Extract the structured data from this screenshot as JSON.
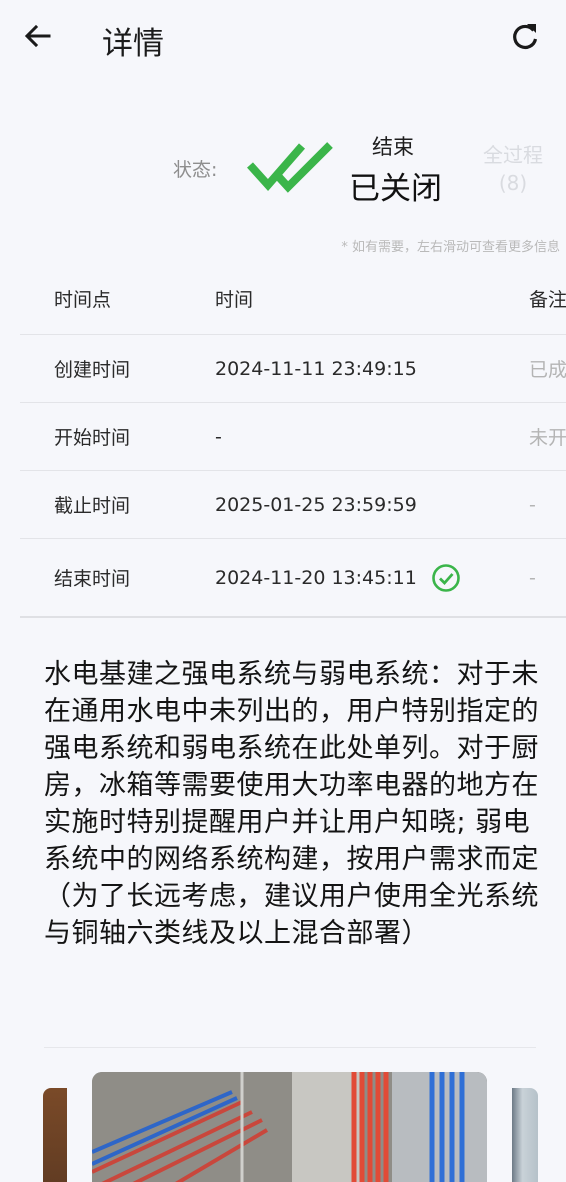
{
  "header": {
    "title": "详情",
    "back_icon": "arrow-left-icon",
    "refresh_icon": "refresh-icon"
  },
  "status": {
    "label": "状态:",
    "stage": "结束",
    "state": "已关闭",
    "process_label": "全过程",
    "process_count": "(8)",
    "icon": "double-check-icon",
    "accent_color": "#3bb54a"
  },
  "hint": "* 如有需要，左右滑动可查看更多信息",
  "table": {
    "headers": [
      "时间点",
      "时间",
      "备注"
    ],
    "rows": [
      {
        "point": "创建时间",
        "time": "2024-11-11 23:49:15",
        "note": "已成"
      },
      {
        "point": "开始时间",
        "time": "-",
        "note": "未开"
      },
      {
        "point": "截止时间",
        "time": "2025-01-25 23:59:59",
        "note": "-"
      },
      {
        "point": "结束时间",
        "time": "2024-11-20 13:45:11",
        "note": "-",
        "icon": "check-circle-icon"
      }
    ]
  },
  "description": "水电基建之强电系统与弱电系统：对于未在通用水电中未列出的，用户特别指定的强电系统和弱电系统在此处单列。对于厨房，冰箱等需要使用大功率电器的地方在实施时特别提醒用户并让用户知晓; 弱电系统中的网络系统构建，按用户需求而定（为了长远考虑，建议用户使用全光系统与铜轴六类线及以上混合部署）"
}
